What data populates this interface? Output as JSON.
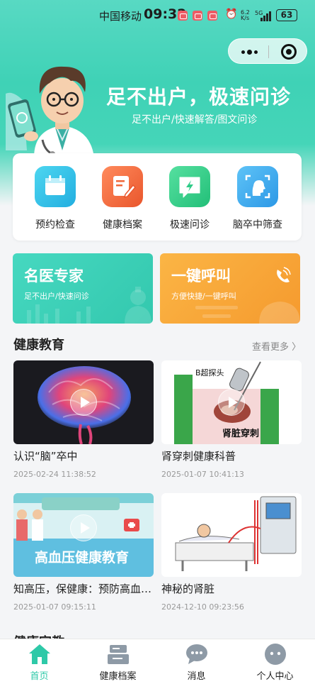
{
  "status_bar": {
    "carrier": "中国移动",
    "time": "09:32",
    "speed_value": "6.2",
    "speed_unit": "K/s",
    "network": "5G",
    "battery": "63"
  },
  "hero": {
    "title": "足不出户，极速问诊",
    "subtitle": "足不出户/快速解答/图文问诊"
  },
  "quick_actions": [
    {
      "label": "预约检查",
      "icon": "calendar-icon",
      "color": "#33c2e6"
    },
    {
      "label": "健康档案",
      "icon": "edit-document-icon",
      "color": "#f0673a"
    },
    {
      "label": "极速问诊",
      "icon": "flash-chat-icon",
      "color": "#2ecb87"
    },
    {
      "label": "脑卒中筛查",
      "icon": "head-scan-icon",
      "color": "#35a9ee"
    }
  ],
  "promos": [
    {
      "title": "名医专家",
      "subtitle": "足不出户/快速问诊",
      "color": "#3dd0b6"
    },
    {
      "title": "一键呼叫",
      "subtitle": "方便快捷/一键呼叫",
      "color": "#f7a63a"
    }
  ],
  "education": {
    "title": "健康教育",
    "more": "查看更多 〉",
    "items": [
      {
        "title": "认识“脑”卒中",
        "date": "2025-02-24 11:38:52",
        "video": true
      },
      {
        "title": "肾穿刺健康科普",
        "date": "2025-01-07 10:41:13",
        "video": true,
        "image_labels": [
          "B超探头",
          "肾脏穿刺"
        ]
      },
      {
        "title": "知高压，保健康：预防高血压，从我做起",
        "date": "2025-01-07 09:15:11",
        "video": true,
        "image_labels": [
          "高血压健康教育"
        ]
      },
      {
        "title": "神秘的肾脏",
        "date": "2024-12-10 09:23:56",
        "video": false
      }
    ]
  },
  "next_section": {
    "title": "健康宣教"
  },
  "tabbar": [
    {
      "label": "首页",
      "icon": "home-icon",
      "active": true
    },
    {
      "label": "健康档案",
      "icon": "archive-icon",
      "active": false
    },
    {
      "label": "消息",
      "icon": "message-icon",
      "active": false
    },
    {
      "label": "个人中心",
      "icon": "user-icon",
      "active": false
    }
  ],
  "colors": {
    "accent": "#2ec9a8"
  }
}
